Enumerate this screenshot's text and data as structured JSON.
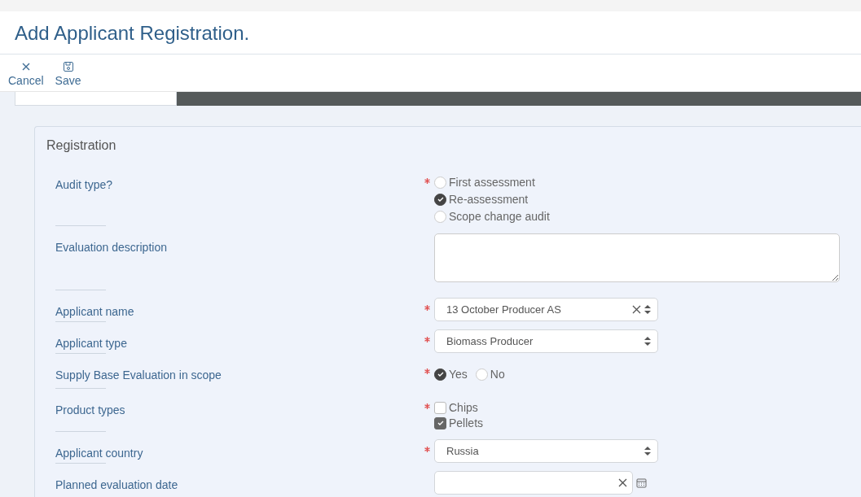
{
  "window": {
    "title": "Add Applicant Registration."
  },
  "toolbar": [
    {
      "kind": "cancel",
      "label": "Cancel"
    },
    {
      "kind": "save",
      "label": "Save"
    }
  ],
  "section": {
    "title": "Registration",
    "fields": [
      {
        "label": "Audit type?",
        "required": true,
        "kind": "radio-stack",
        "options": [
          {
            "label": "First assessment",
            "selected": false
          },
          {
            "label": "Re-assessment",
            "selected": true
          },
          {
            "label": "Scope change audit",
            "selected": false
          }
        ]
      },
      {
        "label": "Evaluation description",
        "required": false,
        "kind": "textarea"
      },
      {
        "label": "Applicant name",
        "required": true,
        "kind": "select",
        "value": "13 October Producer AS",
        "clearable": true
      },
      {
        "label": "Applicant type",
        "required": true,
        "kind": "select",
        "value": "Biomass Producer",
        "clearable": false
      },
      {
        "label": "Supply Base Evaluation in scope",
        "required": true,
        "kind": "radio-inline",
        "options": [
          {
            "label": "Yes",
            "selected": true
          },
          {
            "label": "No",
            "selected": false
          }
        ]
      },
      {
        "label": "Product types",
        "required": true,
        "kind": "checkbox",
        "options": [
          {
            "label": "Chips",
            "checked": false
          },
          {
            "label": "Pellets",
            "checked": true
          }
        ]
      },
      {
        "label": "Applicant country",
        "required": true,
        "kind": "select",
        "value": "Russia",
        "clearable": false
      },
      {
        "label": "Planned evaluation date",
        "required": false,
        "kind": "date"
      }
    ]
  }
}
